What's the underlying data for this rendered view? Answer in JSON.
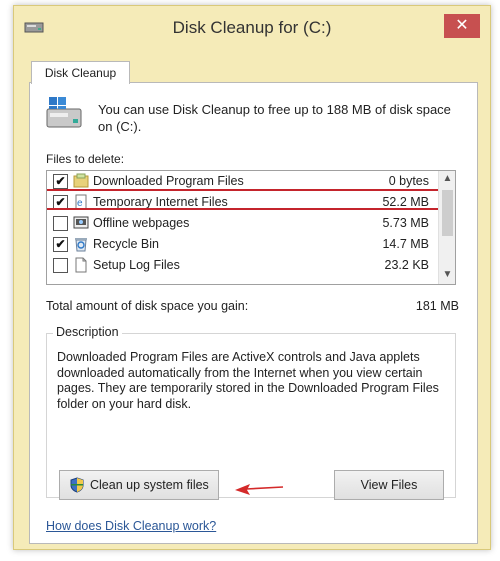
{
  "window": {
    "title": "Disk Cleanup for  (C:)",
    "close_glyph": "✕"
  },
  "tabs": [
    {
      "label": "Disk Cleanup"
    }
  ],
  "intro": "You can use Disk Cleanup to free up to 188 MB of disk space on  (C:).",
  "files_label": "Files to delete:",
  "files": [
    {
      "name": "Downloaded Program Files",
      "size": "0 bytes",
      "checked": true,
      "icon": "folder-icon"
    },
    {
      "name": "Temporary Internet Files",
      "size": "52.2 MB",
      "checked": true,
      "icon": "internet-files-icon",
      "highlighted": true
    },
    {
      "name": "Offline webpages",
      "size": "5.73 MB",
      "checked": false,
      "icon": "offline-webpages-icon"
    },
    {
      "name": "Recycle Bin",
      "size": "14.7 MB",
      "checked": true,
      "icon": "recycle-bin-icon"
    },
    {
      "name": "Setup Log Files",
      "size": "23.2 KB",
      "checked": false,
      "icon": "document-icon"
    }
  ],
  "total": {
    "label": "Total amount of disk space you gain:",
    "value": "181 MB"
  },
  "description": {
    "title": "Description",
    "text": "Downloaded Program Files are ActiveX controls and Java applets downloaded automatically from the Internet when you view certain pages. They are temporarily stored in the Downloaded Program Files folder on your hard disk."
  },
  "buttons": {
    "cleanup_label": "Clean up system files",
    "view_label": "View Files"
  },
  "help_link": "How does Disk Cleanup work?",
  "colors": {
    "accent_highlight": "#c4242c",
    "close_button": "#c75050",
    "window_frame": "#f5ebb8",
    "link": "#2b5797"
  }
}
